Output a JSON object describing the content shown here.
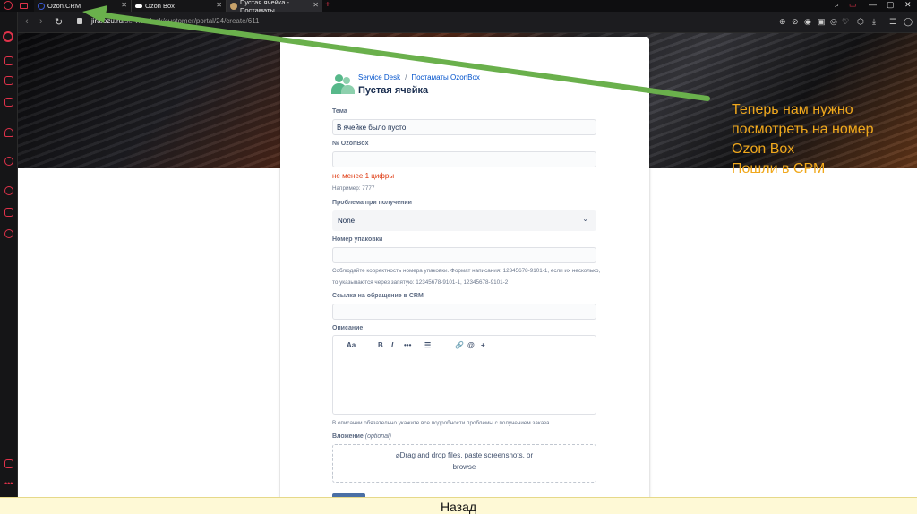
{
  "browser": {
    "tabs": [
      {
        "title": "Ozon.CRM",
        "favicon_color": "#3b5bdb"
      },
      {
        "title": "Ozon Box",
        "favicon_color": "#ffffff"
      },
      {
        "title": "Пустая ячейка - Постаматы",
        "favicon_color": "#c9a36b"
      }
    ],
    "url_domain": "jira.ozu.ru",
    "url_path": "/servicedesk/customer/portal/24/create/611",
    "add_tab": "+",
    "close": "✕"
  },
  "form": {
    "breadcrumb": [
      "Service Desk",
      "Постаматы OzonBox"
    ],
    "breadcrumb_sep": "/",
    "title": "Пустая ячейка",
    "topic_label": "Тема",
    "topic_value": "В ячейке было пусто",
    "ozonbox_label": "№ OzonBox",
    "ozonbox_value": "",
    "ozonbox_error": "не менее 1 цифры",
    "ozonbox_hint": "Например: 7777",
    "problem_label": "Проблема при получении",
    "problem_value": "None",
    "package_label": "Номер упаковки",
    "package_value": "",
    "package_hint": "Соблюдайте корректность номера упаковки. Формат написания: 12345678-9101-1, если их несколько, то указываются через запятую: 12345678-9101-1, 12345678-9101-2",
    "crm_link_label": "Ссылка на обращение в CRM",
    "crm_link_value": "",
    "description_label": "Описание",
    "editor_tools": [
      "Aa",
      "B",
      "I",
      "•••",
      "☰",
      "🔗",
      "@",
      "+"
    ],
    "description_hint": "В описании обязательно укажите все подробности проблемы с получением заказа",
    "attachment_label": "Вложение",
    "attachment_optional": "(optional)",
    "attachment_drop": "Drag and drop files, paste screenshots, or",
    "attachment_browse": "browse"
  },
  "overlay_text": "Теперь нам нужно\nпосмотреть на номер\nOzon Box\nПошли в СРМ",
  "bottom_button": "Назад",
  "colors": {
    "accent": "#f0a81c",
    "arrow": "#6ab04c",
    "opera_red": "#e0324a",
    "link": "#0052cc",
    "error": "#de350b"
  }
}
